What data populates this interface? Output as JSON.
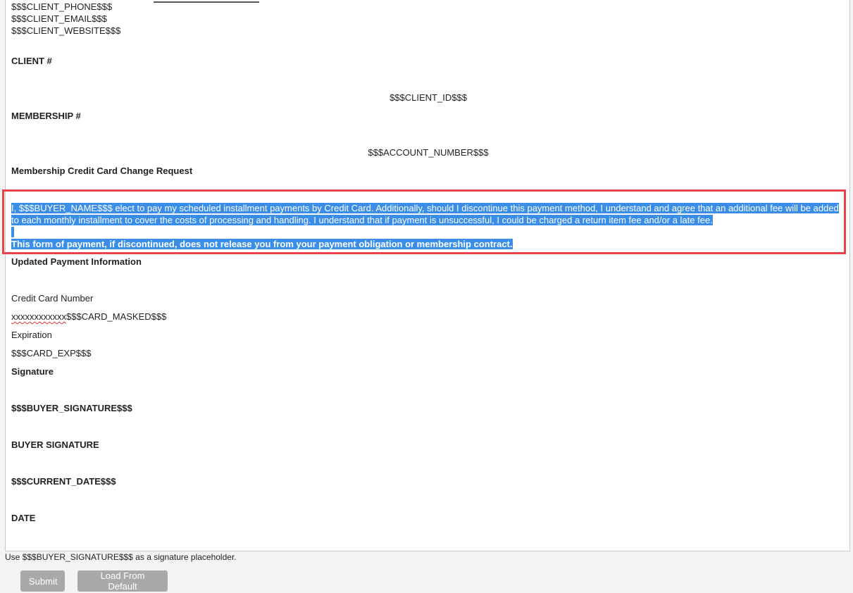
{
  "editor": {
    "header_lines": [
      "$$$CLIENT_PHONE$$$",
      "$$$CLIENT_EMAIL$$$",
      "$$$CLIENT_WEBSITE$$$"
    ],
    "client_label": "CLIENT #",
    "client_value": "$$$CLIENT_ID$$$",
    "membership_label": "MEMBERSHIP #",
    "membership_value": "$$$ACCOUNT_NUMBER$$$",
    "request_title": "Membership Credit Card Change Request",
    "selected_paragraph": "I, $$$BUYER_NAME$$$ elect to pay my scheduled installment payments by Credit Card. Additionally, should I discontinue this payment method, I understand and agree that an additional fee will be added to each monthly installment to cover the costs of processing and handling. I understand that if payment is unsuccessful, I could be charged a return item fee and/or a late fee.",
    "selected_notice": "This form of payment, if discontinued, does not release you from your payment obligation or membership contract.",
    "payment_heading": "Updated Payment Information",
    "card_number_label": "Credit Card Number",
    "card_number_prefix": "xxxxxxxxxxxx",
    "card_number_value": "$$$CARD_MASKED$$$",
    "expiration_label": "Expiration",
    "expiration_value": "$$$CARD_EXP$$$",
    "signature_label": "Signature",
    "signature_value": "$$$BUYER_SIGNATURE$$$",
    "buyer_signature_label": "BUYER SIGNATURE",
    "current_date_value": "$$$CURRENT_DATE$$$",
    "date_label": "DATE"
  },
  "hint": "Use $$$BUYER_SIGNATURE$$$ as a signature placeholder.",
  "buttons": {
    "submit": "Submit",
    "load_default": "Load From Default"
  },
  "colors": {
    "selection": "#3b8ee8",
    "highlight_border": "#e8434a",
    "button_bg": "#a9a9a9"
  }
}
